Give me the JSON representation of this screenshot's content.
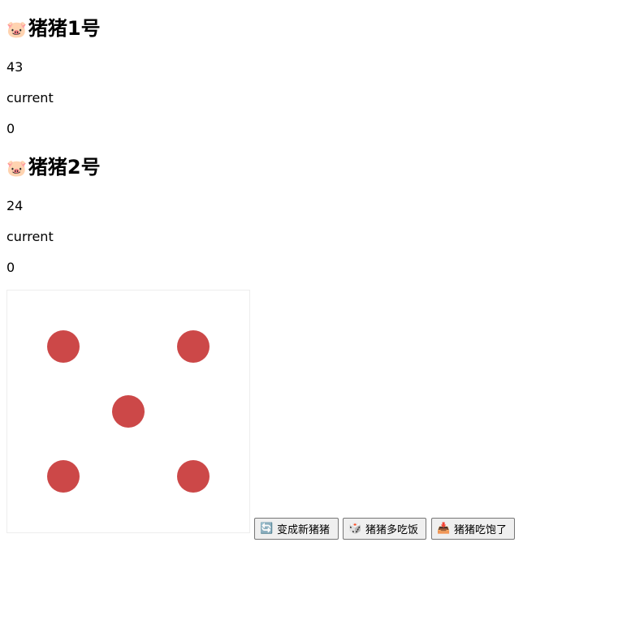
{
  "players": [
    {
      "emoji": "🐷",
      "name": "猪猪1号",
      "score": "43",
      "current_label": "current",
      "current": "0"
    },
    {
      "emoji": "🐷",
      "name": "猪猪2号",
      "score": "24",
      "current_label": "current",
      "current": "0"
    }
  ],
  "dice": {
    "value": 5,
    "pip_color": "#cc4848"
  },
  "buttons": {
    "new_game": {
      "icon": "refresh-icon",
      "glyph": "🔄",
      "label": "变成新猪猪"
    },
    "roll": {
      "icon": "dice-icon",
      "glyph": "🎲",
      "label": "猪猪多吃饭"
    },
    "hold": {
      "icon": "inbox-tray-icon",
      "glyph": "📥",
      "label": "猪猪吃饱了"
    }
  }
}
